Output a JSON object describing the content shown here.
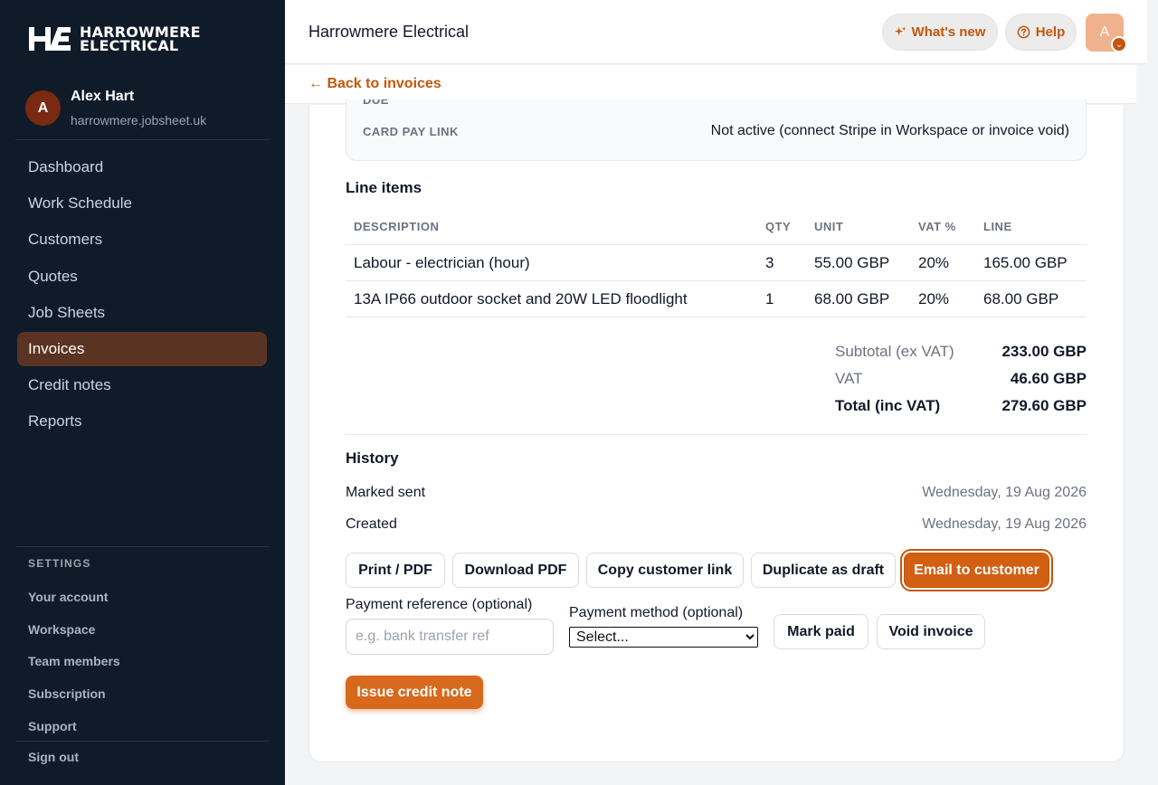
{
  "brand": {
    "name_line1": "HARROWMERE",
    "name_line2": "ELECTRICAL"
  },
  "user": {
    "initial": "A",
    "name": "Alex Hart",
    "domain": "harrowmere.jobsheet.uk"
  },
  "nav": {
    "items": [
      {
        "label": "Dashboard",
        "active": false
      },
      {
        "label": "Work Schedule",
        "active": false
      },
      {
        "label": "Customers",
        "active": false
      },
      {
        "label": "Quotes",
        "active": false
      },
      {
        "label": "Job Sheets",
        "active": false
      },
      {
        "label": "Invoices",
        "active": true
      },
      {
        "label": "Credit notes",
        "active": false
      },
      {
        "label": "Reports",
        "active": false
      }
    ]
  },
  "settings": {
    "heading": "SETTINGS",
    "items": [
      "Your account",
      "Workspace",
      "Team members",
      "Subscription",
      "Support"
    ],
    "sign_out": "Sign out"
  },
  "topbar": {
    "title": "Harrowmere Electrical",
    "whats_new": "What's new",
    "help": "Help",
    "avatar_initial": "A"
  },
  "back_link": "← Back to invoices",
  "payment_box": {
    "due_label": "DUE",
    "card_pay_label": "CARD PAY LINK",
    "card_pay_value": "Not active (connect Stripe in Workspace or invoice void)"
  },
  "line_items": {
    "title": "Line items",
    "headers": {
      "description": "DESCRIPTION",
      "qty": "QTY",
      "unit": "UNIT",
      "vat": "VAT %",
      "line": "LINE"
    },
    "rows": [
      {
        "description": "Labour - electrician (hour)",
        "qty": "3",
        "unit": "55.00 GBP",
        "vat": "20%",
        "line": "165.00 GBP"
      },
      {
        "description": "13A IP66 outdoor socket and 20W LED floodlight",
        "qty": "1",
        "unit": "68.00 GBP",
        "vat": "20%",
        "line": "68.00 GBP"
      }
    ]
  },
  "totals": {
    "subtotal_label": "Subtotal (ex VAT)",
    "subtotal_value": "233.00 GBP",
    "vat_label": "VAT",
    "vat_value": "46.60 GBP",
    "total_label": "Total (inc VAT)",
    "total_value": "279.60 GBP"
  },
  "history": {
    "title": "History",
    "events": [
      {
        "label": "Marked sent",
        "date": "Wednesday, 19 Aug 2026"
      },
      {
        "label": "Created",
        "date": "Wednesday, 19 Aug 2026"
      }
    ]
  },
  "actions": {
    "print": "Print / PDF",
    "download": "Download PDF",
    "copy_link": "Copy customer link",
    "duplicate": "Duplicate as draft",
    "email": "Email to customer",
    "mark_paid": "Mark paid",
    "void": "Void invoice",
    "issue_credit": "Issue credit note"
  },
  "payment_form": {
    "reference_label": "Payment reference (optional)",
    "reference_placeholder": "e.g. bank transfer ref",
    "method_label": "Payment method (optional)",
    "method_selected": "Select..."
  },
  "colors": {
    "accent": "#c2570c",
    "sidebar_bg": "#101b2a",
    "active_nav_bg": "#5a3322"
  }
}
